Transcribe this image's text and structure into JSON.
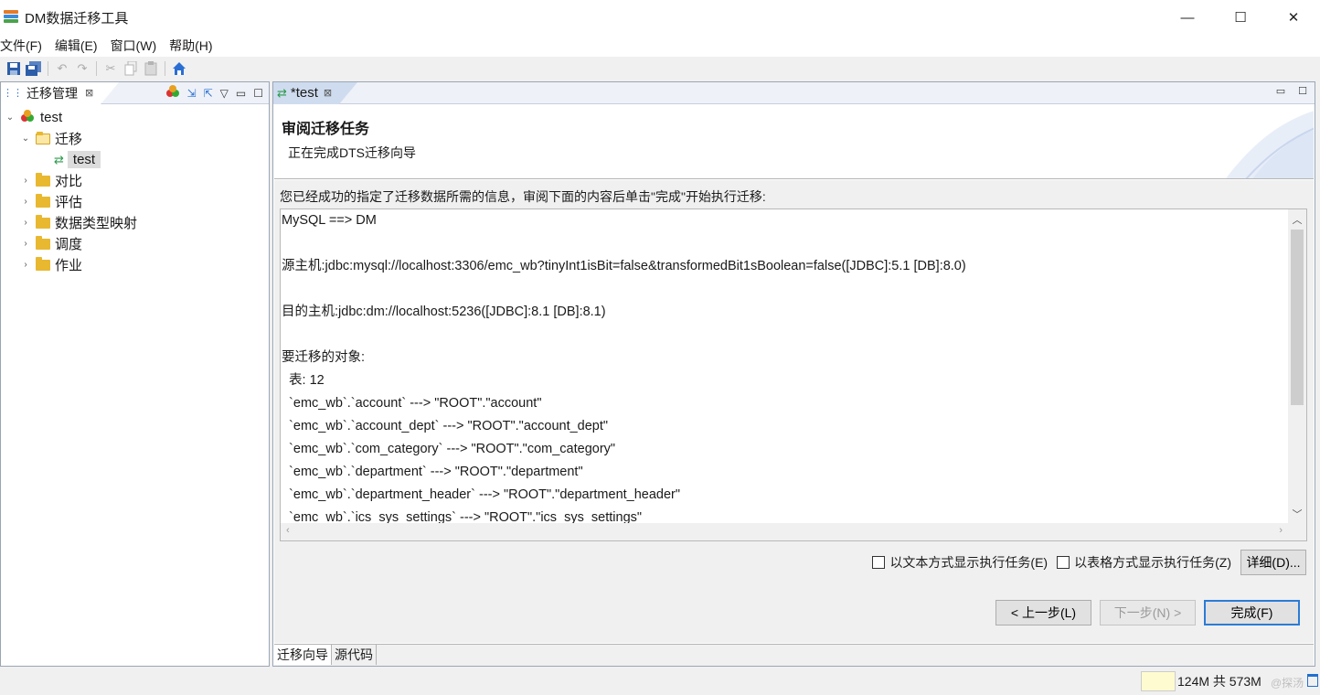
{
  "window": {
    "title": "DM数据迁移工具",
    "controls": [
      "—",
      "☐",
      "✕"
    ]
  },
  "menu": [
    "文件(F)",
    "编辑(E)",
    "窗口(W)",
    "帮助(H)"
  ],
  "left_panel": {
    "tab_label": "迁移管理",
    "tree": {
      "root": "test",
      "migration_folder": "迁移",
      "migration_item": "test",
      "folders": [
        "对比",
        "评估",
        "数据类型映射",
        "调度",
        "作业"
      ]
    }
  },
  "editor": {
    "tab_label": "*test",
    "wizard_title": "审阅迁移任务",
    "wizard_subtitle": "正在完成DTS迁移向导",
    "intro": "您已经成功的指定了迁移数据所需的信息，审阅下面的内容后单击\"完成\"开始执行迁移:",
    "summary_lines": [
      "MySQL ==> DM",
      "",
      "源主机:jdbc:mysql://localhost:3306/emc_wb?tinyInt1isBit=false&transformedBit1sBoolean=false([JDBC]:5.1 [DB]:8.0)",
      "",
      "目的主机:jdbc:dm://localhost:5236([JDBC]:8.1 [DB]:8.1)",
      "",
      "要迁移的对象:",
      "  表: 12",
      "  `emc_wb`.`account` ---> \"ROOT\".\"account\"",
      "  `emc_wb`.`account_dept` ---> \"ROOT\".\"account_dept\"",
      "  `emc_wb`.`com_category` ---> \"ROOT\".\"com_category\"",
      "  `emc_wb`.`department` ---> \"ROOT\".\"department\"",
      "  `emc_wb`.`department_header` ---> \"ROOT\".\"department_header\"",
      "  `emc_wb`.`ics_sys_settings` ---> \"ROOT\".\"ics_sys_settings\""
    ],
    "options": {
      "text_mode_label": "以文本方式显示执行任务(E)",
      "table_mode_label": "以表格方式显示执行任务(Z)",
      "detail_button": "详细(D)..."
    },
    "buttons": {
      "back": "< 上一步(L)",
      "next": "下一步(N) >",
      "finish": "完成(F)"
    },
    "bottom_tabs": [
      "迁移向导",
      "源代码"
    ]
  },
  "status": {
    "heap": "124M 共 573M",
    "watermark": "@探汤"
  }
}
